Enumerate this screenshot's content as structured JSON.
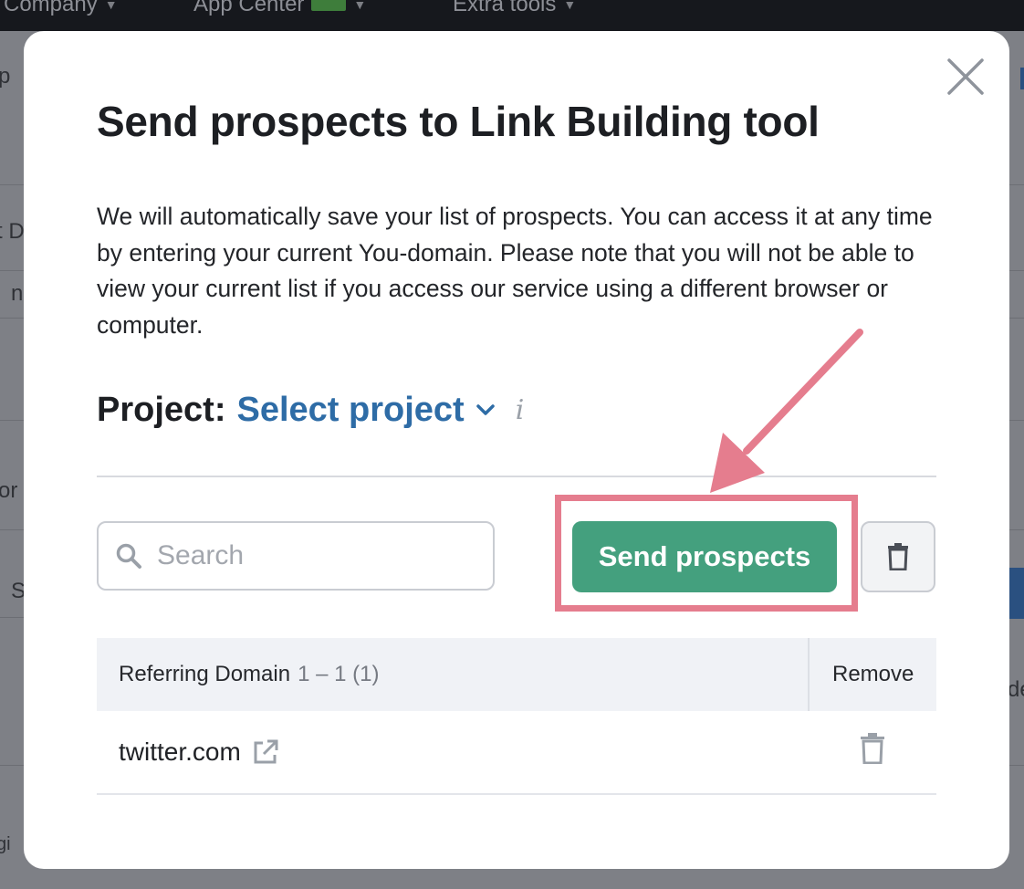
{
  "topbar": {
    "nav": [
      "Company",
      "App Center",
      "Extra tools"
    ]
  },
  "background": {
    "fragments": [
      "p",
      "t D",
      "n",
      "or",
      "S",
      "de",
      "gi"
    ]
  },
  "modal": {
    "title": "Send prospects to Link Building tool",
    "description": "We will automatically save your list of prospects. You can access it at any time by entering your current You-domain. Please note that you will not be able to view your current list if you access our service using a different browser or computer.",
    "project": {
      "label": "Project:",
      "select_label": "Select project",
      "info_symbol": "i"
    },
    "search": {
      "placeholder": "Search",
      "value": ""
    },
    "send_button_label": "Send prospects",
    "table": {
      "columns": {
        "domain": "Referring Domain",
        "range": "1 – 1 (1)",
        "remove": "Remove"
      },
      "rows": [
        {
          "domain": "twitter.com"
        }
      ]
    }
  },
  "colors": {
    "accent_green": "#44a07e",
    "link_blue": "#2e6ca6",
    "highlight_pink": "#e57d8e"
  },
  "icons": [
    "close-icon",
    "chevron-down-icon",
    "info-icon",
    "search-icon",
    "trash-icon",
    "external-link-icon",
    "arrow-annotation"
  ]
}
